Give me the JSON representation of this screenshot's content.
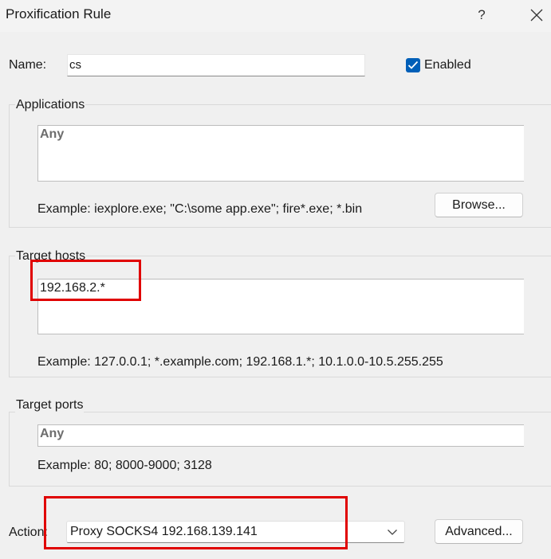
{
  "window": {
    "title": "Proxification Rule",
    "help_label": "?"
  },
  "name": {
    "label": "Name:",
    "value": "cs"
  },
  "enabled": {
    "label": "Enabled",
    "checked": true
  },
  "applications": {
    "legend": "Applications",
    "value": "Any",
    "example": "Example: iexplore.exe; \"C:\\some app.exe\"; fire*.exe; *.bin",
    "browse_label": "Browse..."
  },
  "target_hosts": {
    "legend": "Target hosts",
    "value": "192.168.2.*",
    "example": "Example: 127.0.0.1; *.example.com; 192.168.1.*; 10.1.0.0-10.5.255.255"
  },
  "target_ports": {
    "legend": "Target ports",
    "value": "Any",
    "example": "Example: 80; 8000-9000; 3128"
  },
  "action": {
    "label": "Action:",
    "selected": "Proxy SOCKS4 192.168.139.141",
    "advanced_label": "Advanced..."
  },
  "colors": {
    "accent": "#005fb8",
    "highlight": "#e00000"
  }
}
